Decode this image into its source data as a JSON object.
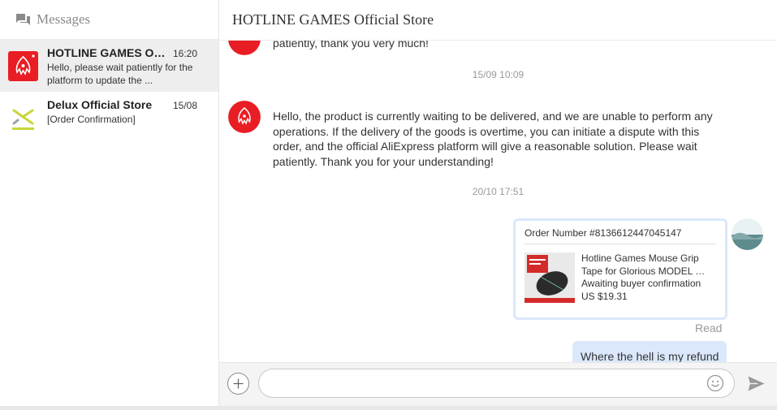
{
  "sidebar": {
    "title": "Messages",
    "conversations": [
      {
        "name": "HOTLINE GAMES Official Store",
        "time": "16:20",
        "preview": "Hello, please wait patiently for the platform to update the ...",
        "logo": "hotline-logo",
        "active": true
      },
      {
        "name": "Delux Official Store",
        "time": "15/08",
        "preview": "[Order Confirmation]",
        "logo": "delux-logo",
        "active": false
      }
    ]
  },
  "chat": {
    "title": "HOTLINE GAMES Official Store",
    "cut_message": "patiently, thank you very much!",
    "date1": "15/09 10:09",
    "message1": "Hello, the product is currently waiting to be delivered, and we are unable to perform any operations. If the delivery of the goods is overtime, you can initiate a dispute with this order, and the official AliExpress platform will give a reasonable solution. Please wait patiently. Thank you for your understanding!",
    "date2": "20/10 17:51",
    "order_card": {
      "order_number": "Order Number #8136612447045147",
      "product_name": "Hotline Games Mouse Grip Tape for Glorious MODEL O- Series Mouse",
      "status": "Awaiting buyer confirmation",
      "price": "US $19.31"
    },
    "read_label": "Read",
    "user_message": "Where the hell is my refund"
  },
  "input": {
    "placeholder": "",
    "value": ""
  },
  "colors": {
    "brand_red": "#e81e24",
    "bubble_blue": "#dbe8fb",
    "active_bg": "#eeeeee"
  }
}
